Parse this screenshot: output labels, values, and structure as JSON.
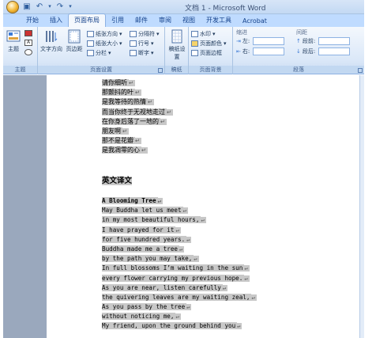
{
  "window": {
    "title": "文档 1 - Microsoft Word"
  },
  "tabs": [
    "开始",
    "插入",
    "页面布局",
    "引用",
    "邮件",
    "审阅",
    "视图",
    "开发工具",
    "Acrobat"
  ],
  "active_tab_index": 2,
  "ribbon": {
    "theme_group": {
      "label": "主题",
      "themes_label": "主题"
    },
    "page_setup_group": {
      "label": "页面设置",
      "text_direction": "文字方向",
      "margins": "页边距",
      "orientation": "纸张方向",
      "size": "纸张大小",
      "columns": "分栏",
      "breaks": "分隔符",
      "line_numbers": "行号",
      "hyphenation": "断字"
    },
    "manuscript_group": {
      "label": "稿纸",
      "manuscript_setup": "稿纸设置"
    },
    "page_background_group": {
      "label": "页面背景",
      "watermark": "水印",
      "page_color": "页面颜色",
      "page_borders": "页面边框"
    },
    "paragraph_group": {
      "label": "段落",
      "indent_label": "缩进",
      "spacing_label": "间距",
      "left": "左:",
      "right": "右:",
      "before": "段前:",
      "after": "段后:"
    }
  },
  "document": {
    "chinese_lines": [
      "请你细听",
      "那颤抖的叶",
      "是我等待的热情",
      "而当你终于无视地走过",
      "在你身后落了一地的",
      "朋友啊",
      "那不是花瓣",
      "是我凋零的心"
    ],
    "english_heading": "英文译文",
    "english_title": "A Blooming Tree",
    "english_lines": [
      "May Buddha let us meet",
      "in my most beautiful hours,",
      "I have prayed for it",
      "for five hundred years.",
      "Buddha made me a tree",
      "by the path you may take,",
      "In full blossoms I’m waiting in the sun",
      "every flower carrying my previous hope.",
      "As you are near, listen carefully",
      "the quivering leaves are my waiting zeal,",
      "As you pass by the tree",
      "without noticing me,",
      "My friend, upon the ground behind you"
    ],
    "paragraph_mark": "↵"
  }
}
